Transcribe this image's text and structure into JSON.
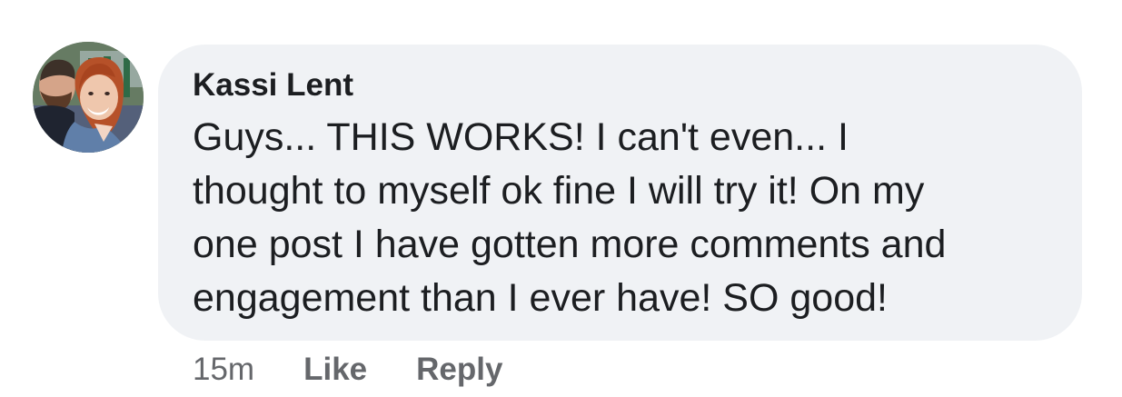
{
  "comment": {
    "author": "Kassi Lent",
    "text_lines": [
      "Guys... THIS WORKS! I can't even... I",
      "thought to myself ok fine I will try it! On my",
      "one post I have gotten more comments and",
      "engagement than I ever have! SO good!"
    ],
    "timestamp": "15m",
    "like_label": "Like",
    "reply_label": "Reply",
    "avatar_icon": "profile-photo-icon"
  },
  "colors": {
    "bubble_background": "#f0f2f5",
    "text_primary": "#1c1e21",
    "text_secondary": "#65676b"
  }
}
